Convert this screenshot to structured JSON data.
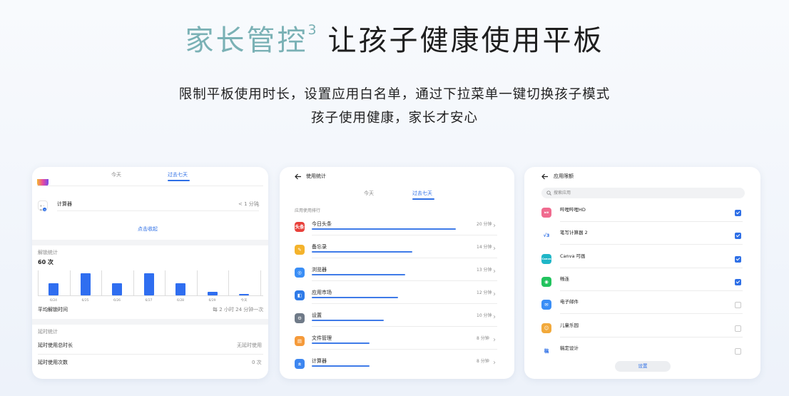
{
  "hero": {
    "title_accent": "家长管控",
    "title_sup": "3",
    "title_rest": "让孩子健康使用平板"
  },
  "subtitle": {
    "line1": "限制平板使用时长，设置应用白名单，通过下拉菜单一键切换孩子模式",
    "line2": "孩子使用健康，家长才安心"
  },
  "colors": {
    "accent_teal": "#7ab1b5",
    "brand_blue": "#2e6fe6",
    "bar_blue": "#2f6ef0"
  },
  "screen1": {
    "tabs": [
      "今天",
      "过去七天"
    ],
    "active_tab": 1,
    "calc_row": {
      "name": "计算器",
      "value": "< 1 分钟",
      "icon": "calculator-icon"
    },
    "collapse_link": "点击收起",
    "unlock": {
      "section": "解锁统计",
      "count": "60 次"
    },
    "chart_data": {
      "type": "bar",
      "categories": [
        "6/24",
        "6/25",
        "6/26",
        "6/27",
        "6/28",
        "6/29",
        "今天"
      ],
      "values": [
        10,
        18,
        10,
        18,
        10,
        3,
        1
      ],
      "ylim": [
        0,
        20
      ],
      "grid": false
    },
    "avg_label": "平均解锁时间",
    "avg_value": "每 2 小时 24 分钟一次",
    "delay_section": "延时统计",
    "delay_rows": [
      {
        "label": "延时使用总时长",
        "value": "无延时使用"
      },
      {
        "label": "延时使用次数",
        "value": "0 次"
      }
    ]
  },
  "screen2": {
    "title": "使用统计",
    "back_icon": "arrow-left-icon",
    "tabs": [
      "今天",
      "过去七天"
    ],
    "active_tab": 1,
    "section": "应用使用排行",
    "apps": [
      {
        "name": "今日头条",
        "time": "20 分钟",
        "fraction": 1.0,
        "color": "#e8403a",
        "icon": "toutiao-icon",
        "glyph": "头条"
      },
      {
        "name": "备忘录",
        "time": "14 分钟",
        "fraction": 0.7,
        "color": "#f4b32c",
        "icon": "memo-icon",
        "glyph": "✎"
      },
      {
        "name": "浏览器",
        "time": "13 分钟",
        "fraction": 0.65,
        "color": "#3a8ef6",
        "icon": "browser-icon",
        "glyph": "◎"
      },
      {
        "name": "应用市场",
        "time": "12 分钟",
        "fraction": 0.6,
        "color": "#2f7be8",
        "icon": "app-market-icon",
        "glyph": "◧"
      },
      {
        "name": "设置",
        "time": "10 分钟",
        "fraction": 0.5,
        "color": "#6f7a88",
        "icon": "settings-icon",
        "glyph": "⚙"
      },
      {
        "name": "文件管理",
        "time": "8 分钟",
        "fraction": 0.4,
        "color": "#f59a3a",
        "icon": "file-manager-icon",
        "glyph": "▤"
      },
      {
        "name": "计算器",
        "time": "8 分钟",
        "fraction": 0.4,
        "color": "#3d86f0",
        "icon": "calculator-icon",
        "glyph": "±"
      }
    ]
  },
  "screen3": {
    "title": "应用限额",
    "back_icon": "arrow-left-icon",
    "search_placeholder": "搜索应用",
    "search_icon": "search-icon",
    "apps": [
      {
        "name": "哔哩哔哩HD",
        "checked": true,
        "color": "#f06b8f",
        "icon": "bilibili-icon",
        "glyph": "bili"
      },
      {
        "name": "笔写计算器 2",
        "checked": true,
        "color": "#ffffff",
        "icon": "handwriting-calculator-icon",
        "glyph": "√3"
      },
      {
        "name": "Canva 可画",
        "checked": true,
        "color": "#1fb6c7",
        "icon": "canva-icon",
        "glyph": "Canva"
      },
      {
        "name": "畅连",
        "checked": true,
        "color": "#22c35e",
        "icon": "changlian-icon",
        "glyph": "◉"
      },
      {
        "name": "电子邮件",
        "checked": false,
        "color": "#3a8ef6",
        "icon": "email-icon",
        "glyph": "✉"
      },
      {
        "name": "儿童乐园",
        "checked": false,
        "color": "#f2a93b",
        "icon": "kids-park-icon",
        "glyph": "☺"
      },
      {
        "name": "稿定设计",
        "checked": false,
        "color": "#ffffff",
        "icon": "gaoding-icon",
        "glyph": "稿"
      }
    ],
    "button": "设置"
  }
}
